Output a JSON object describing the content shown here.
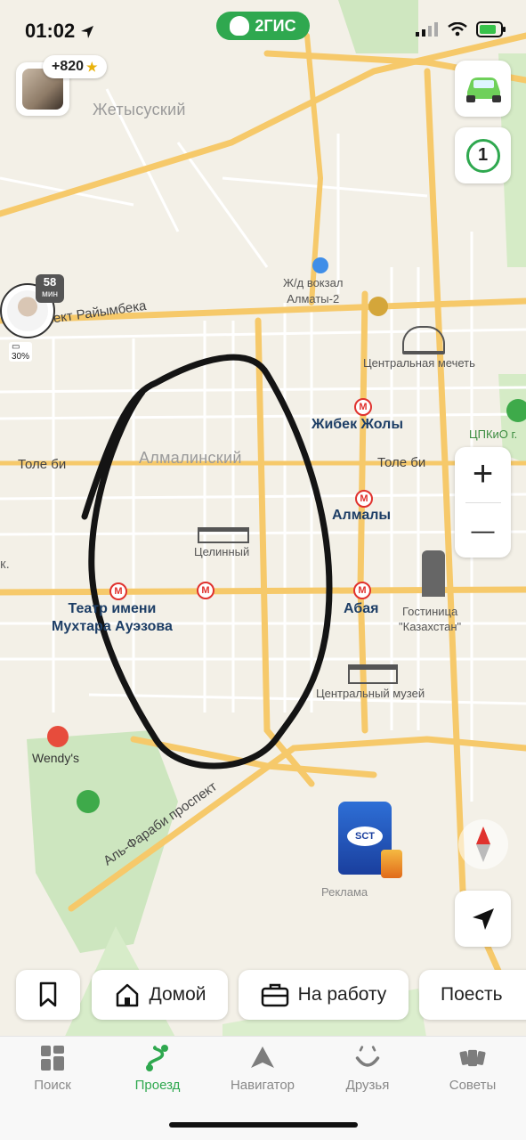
{
  "status_bar": {
    "time": "01:02"
  },
  "app": {
    "logo_text": "2ГИС"
  },
  "user": {
    "points": "+820"
  },
  "friend_marker": {
    "minutes": "58",
    "minutes_unit": "мин",
    "battery": "30%"
  },
  "map": {
    "districts": {
      "zhetysu": "Жетысуский",
      "almaly": "Алмалинский"
    },
    "streets": {
      "raiymbek": "проспект Райымбека",
      "tole_bi_left": "Толе би",
      "tole_bi_right": "Толе би",
      "al_farabi": "Аль-Фараби проспект",
      "left_cut": "к."
    },
    "pois": {
      "railway": "Ж/д вокзал\nАлматы-2",
      "mosque": "Центральная мечеть",
      "tsinny": "Целинный",
      "hotel": "Гостиница\n\"Казахстан\"",
      "museum": "Центральный музей",
      "wendys": "Wendy's",
      "park": "ЦПКиО г."
    },
    "metro": {
      "zhibek": "Жибек Жолы",
      "almaly": "Алмалы",
      "abaya": "Абая",
      "auezov": "Театр имени\nМухтара Ауэзова"
    },
    "metro_icon": "М"
  },
  "controls": {
    "layers_count": "1",
    "zoom_in": "+",
    "zoom_out": "—"
  },
  "ad": {
    "label": "Реклама",
    "brand": "SCT"
  },
  "quick_chips": {
    "home": "Домой",
    "work": "На работу",
    "eat": "Поесть"
  },
  "bottom_nav": [
    {
      "label": "Поиск",
      "icon": "grid-icon"
    },
    {
      "label": "Проезд",
      "icon": "route-icon",
      "active": true
    },
    {
      "label": "Навигатор",
      "icon": "navigator-icon"
    },
    {
      "label": "Друзья",
      "icon": "friends-icon"
    },
    {
      "label": "Советы",
      "icon": "cards-icon"
    }
  ],
  "colors": {
    "accent": "#2fa84f",
    "metro": "#e0322e",
    "road": "#f6c96a"
  }
}
